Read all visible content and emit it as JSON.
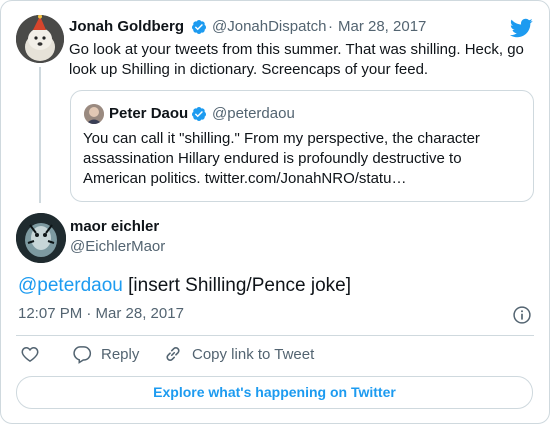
{
  "colors": {
    "twitter_blue": "#1d9bf0",
    "text": "#0f1419",
    "secondary": "#536471",
    "border": "#cfd9de"
  },
  "parent_tweet": {
    "author_name": "Jonah Goldberg",
    "handle": "@JonahDispatch",
    "separator": "·",
    "date": "Mar 28, 2017",
    "lines": [
      "Go look at your tweets from this summer. That was shilling. Heck, go",
      "look up Shilling in dictionary. Screencaps of your feed."
    ]
  },
  "quoted_tweet": {
    "author_name": "Peter Daou",
    "handle": "@peterdaou",
    "lines": [
      "You can call it \"shilling.\" From my perspective, the character",
      "assassination Hillary endured is profoundly destructive to",
      "American politics. twitter.com/JonahNRO/statu…"
    ]
  },
  "main_tweet": {
    "author_name": "maor eichler",
    "handle": "@EichlerMaor",
    "mention": "@peterdaou",
    "text": " [insert Shilling/Pence joke]",
    "timestamp": "12:07 PM · Mar 28, 2017"
  },
  "actions": {
    "reply": "Reply",
    "copy_link": "Copy link to Tweet"
  },
  "explore_label": "Explore what's happening on Twitter",
  "icons": [
    "twitter-bird-icon",
    "verified-badge-icon",
    "info-icon",
    "heart-icon",
    "reply-icon",
    "link-icon"
  ]
}
